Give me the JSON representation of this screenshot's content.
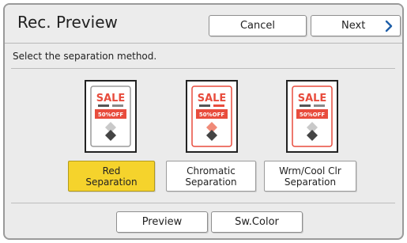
{
  "header": {
    "title": "Rec. Preview",
    "cancel_label": "Cancel",
    "next_label": "Next"
  },
  "instruction": "Select the separation method.",
  "options": [
    {
      "line1": "Red",
      "line2": "Separation",
      "selected": true
    },
    {
      "line1": "Chromatic",
      "line2": "Separation",
      "selected": false
    },
    {
      "line1": "Wrm/Cool Clr",
      "line2": "Separation",
      "selected": false
    }
  ],
  "thumbnail_text": {
    "sale": "SALE",
    "offer": "50%OFF"
  },
  "footer": {
    "preview_label": "Preview",
    "swcolor_label": "Sw.Color"
  },
  "colors": {
    "selected": "#f5d32c",
    "red": "#e84c3d",
    "accent_blue": "#1f5fa8"
  },
  "icons": {
    "next": "chevron-right-icon"
  }
}
